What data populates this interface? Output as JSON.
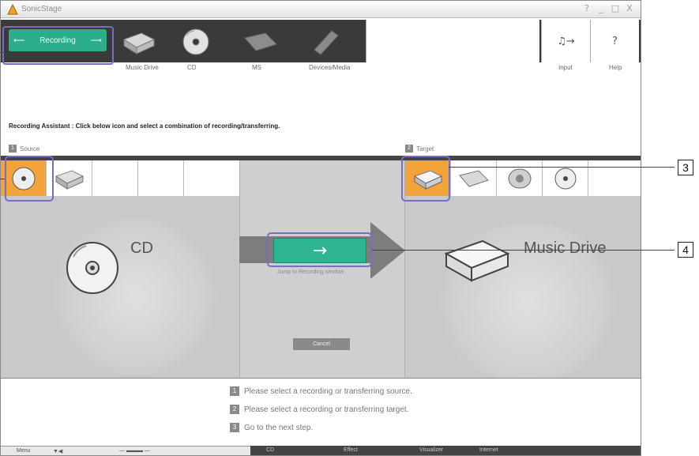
{
  "window": {
    "title": "SonicStage",
    "controls": [
      "?",
      "_",
      "□",
      "X"
    ]
  },
  "toolbar": {
    "recording_label": "Recording",
    "tools": [
      {
        "label": "Music Drive",
        "icon": "music-drive-icon"
      },
      {
        "label": "CD",
        "icon": "cd-icon"
      },
      {
        "label": "MS",
        "icon": "memory-stick-icon"
      },
      {
        "label": "Devices/Media",
        "icon": "devices-media-icon"
      }
    ],
    "input_label": "Input",
    "help_label": "Help"
  },
  "assistant": {
    "text": "Recording Assistant : Click below icon and select a combination of recording/transferring."
  },
  "source": {
    "number": "1",
    "label": "Source",
    "selected_name": "CD"
  },
  "target": {
    "number": "2",
    "label": "Target",
    "selected_name": "Music Drive"
  },
  "middle": {
    "next_arrow": "→",
    "caption": "Jump to Recording window",
    "cancel_label": "Cancel"
  },
  "steps": [
    {
      "num": "1",
      "text": "Please select a recording or transferring source."
    },
    {
      "num": "2",
      "text": "Please select a recording or transferring target."
    },
    {
      "num": "3",
      "text": "Go to the next step."
    }
  ],
  "statusbar": {
    "menu": "Menu",
    "cd": "CD",
    "effect": "Effect",
    "visualizer": "Visualizer",
    "internet": "Internet"
  },
  "callouts": {
    "three": "3",
    "four": "4"
  },
  "colors": {
    "accent_green": "#2db592",
    "selection_orange": "#f2a43a",
    "highlight_purple": "#7a6cc0",
    "toolbar_dark": "#3a3a3a"
  }
}
